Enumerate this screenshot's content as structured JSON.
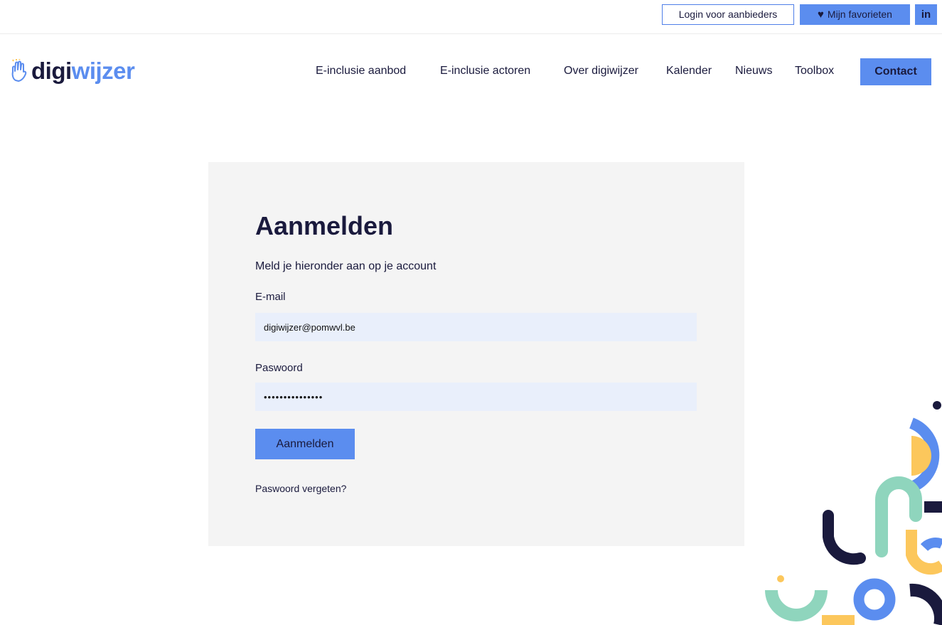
{
  "topbar": {
    "login_label": "Login voor aanbieders",
    "favorites_label": "Mijn favorieten",
    "favorites_icon": "heart-icon",
    "linkedin_label": "in"
  },
  "logo": {
    "part1": "digi",
    "part2": "wijzer",
    "icon": "hand-icon"
  },
  "nav": {
    "items": [
      "E-inclusie aanbod",
      "E-inclusie actoren",
      "Over digiwijzer",
      "Kalender",
      "Nieuws",
      "Toolbox"
    ],
    "contact_label": "Contact"
  },
  "login": {
    "title": "Aanmelden",
    "subtitle": "Meld je hieronder aan op je account",
    "email_label": "E-mail",
    "email_value": "digiwijzer@pomwvl.be",
    "password_label": "Paswoord",
    "password_value": "•••••••••••••••",
    "submit_label": "Aanmelden",
    "forgot_label": "Paswoord vergeten?"
  },
  "colors": {
    "brand_dark": "#1a1a3d",
    "brand_blue": "#5b8def",
    "panel_bg": "#f4f4f4",
    "input_bg": "#e9effb",
    "deco_green": "#8fd5bd",
    "deco_yellow": "#fcc75c"
  }
}
